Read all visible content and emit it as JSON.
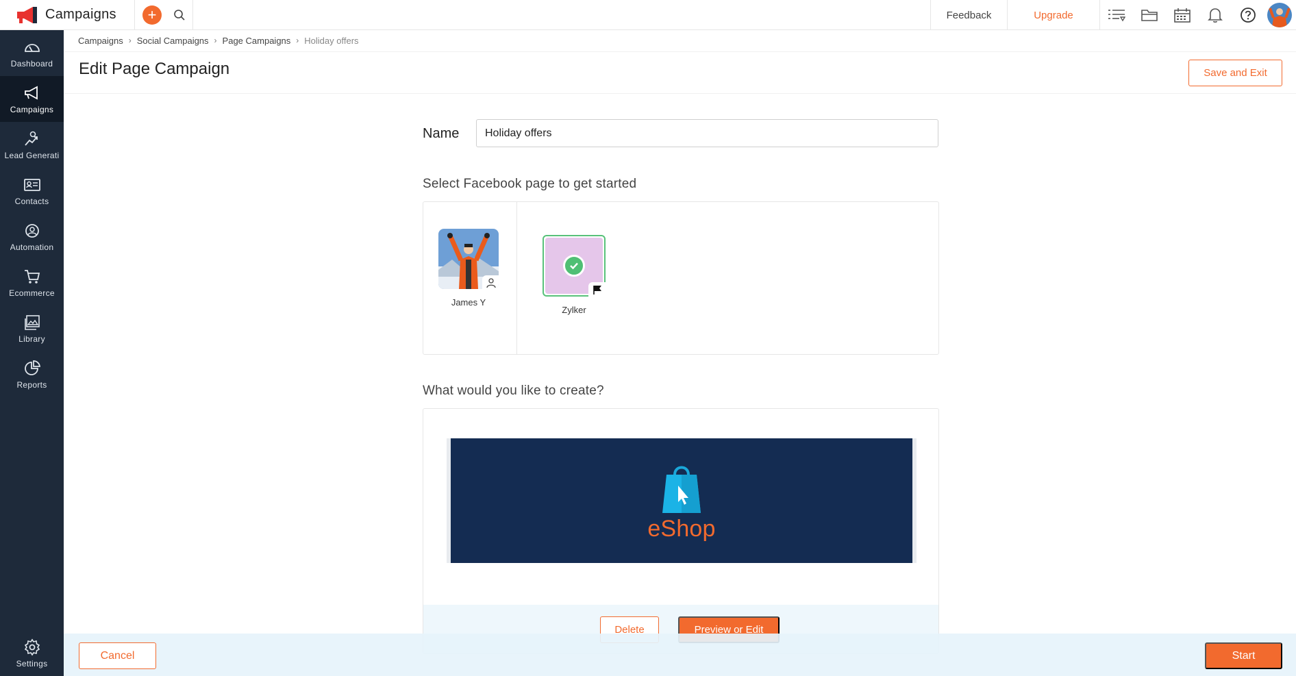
{
  "app": {
    "title": "Campaigns"
  },
  "topbar": {
    "feedback": "Feedback",
    "upgrade": "Upgrade",
    "plus": "+"
  },
  "sidebar": {
    "items": [
      {
        "label": "Dashboard",
        "icon": "dashboard-icon"
      },
      {
        "label": "Campaigns",
        "icon": "megaphone-icon",
        "active": true
      },
      {
        "label": "Lead Generation",
        "icon": "lead-gen-icon"
      },
      {
        "label": "Contacts",
        "icon": "contacts-icon"
      },
      {
        "label": "Automation",
        "icon": "automation-icon"
      },
      {
        "label": "Ecommerce",
        "icon": "cart-icon"
      },
      {
        "label": "Library",
        "icon": "library-icon"
      },
      {
        "label": "Reports",
        "icon": "reports-icon"
      }
    ],
    "settings": "Settings"
  },
  "breadcrumb": [
    "Campaigns",
    "Social Campaigns",
    "Page Campaigns",
    "Holiday offers"
  ],
  "page": {
    "title": "Edit Page Campaign",
    "save_exit": "Save and Exit",
    "name_label": "Name",
    "name_value": "Holiday offers"
  },
  "select_page": {
    "title": "Select Facebook page to get started",
    "pages": [
      {
        "name": "James Y",
        "type": "profile",
        "selected": false
      },
      {
        "name": "Zylker",
        "type": "page",
        "selected": true
      }
    ]
  },
  "create": {
    "title": "What would you like to create?",
    "banner_text": "eShop",
    "delete": "Delete",
    "preview": "Preview or Edit"
  },
  "footer": {
    "cancel": "Cancel",
    "start": "Start"
  },
  "colors": {
    "accent": "#f26a2e",
    "sidebar": "#1e2a3a",
    "banner": "#142c52",
    "selected": "#58c17a"
  }
}
